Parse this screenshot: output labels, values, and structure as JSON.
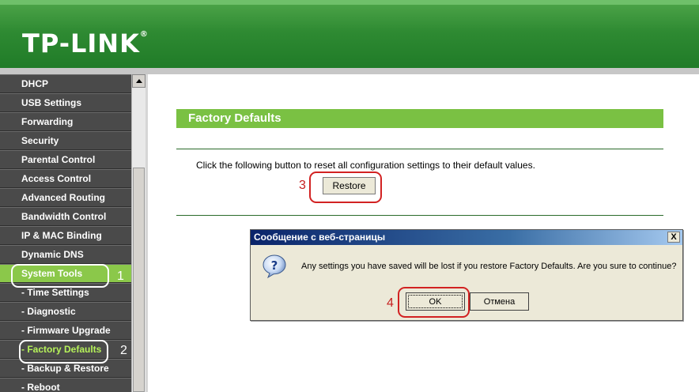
{
  "brand": {
    "logo_text": "TP-LINK",
    "trademark": "®"
  },
  "sidebar": {
    "items": [
      {
        "label": "DHCP"
      },
      {
        "label": "USB Settings"
      },
      {
        "label": "Forwarding"
      },
      {
        "label": "Security"
      },
      {
        "label": "Parental Control"
      },
      {
        "label": "Access Control"
      },
      {
        "label": "Advanced Routing"
      },
      {
        "label": "Bandwidth Control"
      },
      {
        "label": "IP & MAC Binding"
      },
      {
        "label": "Dynamic DNS"
      },
      {
        "label": "System Tools"
      },
      {
        "label": "- Time Settings"
      },
      {
        "label": "- Diagnostic"
      },
      {
        "label": "- Firmware Upgrade"
      },
      {
        "label": "- Factory Defaults"
      },
      {
        "label": "- Backup & Restore"
      },
      {
        "label": "- Reboot"
      }
    ]
  },
  "main": {
    "title": "Factory Defaults",
    "description": "Click the following button to reset all configuration settings to their default values.",
    "restore_label": "Restore"
  },
  "dialog": {
    "title": "Сообщение с веб-страницы",
    "close_label": "X",
    "message": "Any settings you have saved will be lost if you restore Factory Defaults. Are you sure to continue?",
    "ok_label": "OK",
    "cancel_label": "Отмена"
  },
  "annotations": {
    "step1": "1",
    "step2": "2",
    "step3": "3",
    "step4": "4"
  },
  "colors": {
    "brand_green": "#2e8a32",
    "title_green": "#7ac143",
    "active_green": "#8bc84a",
    "annotation_red": "#d22222"
  }
}
